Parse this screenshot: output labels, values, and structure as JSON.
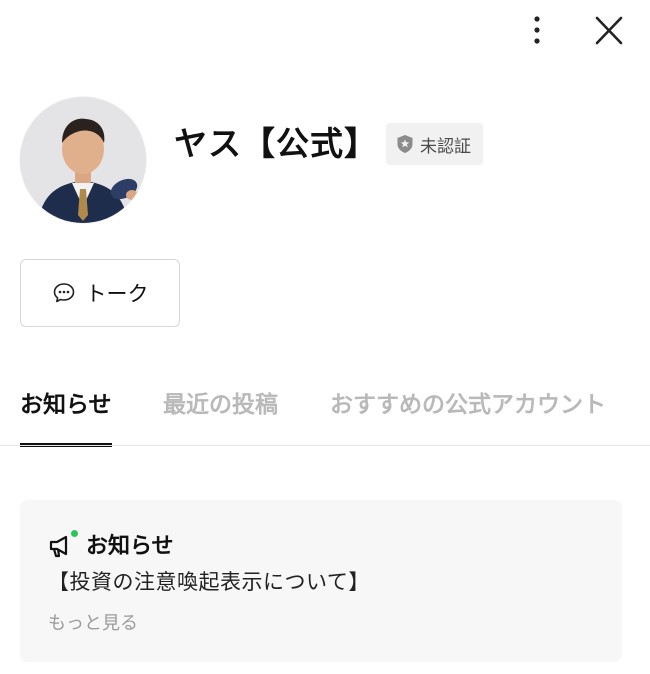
{
  "header": {
    "more_icon": "vertical-dots-icon",
    "close_icon": "close-icon"
  },
  "profile": {
    "name": "ヤス【公式】",
    "badge_label": "未認証",
    "badge_icon": "shield-star-icon",
    "avatar": "profile-photo"
  },
  "actions": {
    "talk_label": "トーク",
    "talk_icon": "chat-bubble-icon"
  },
  "tabs": [
    {
      "label": "お知らせ",
      "active": true
    },
    {
      "label": "最近の投稿",
      "active": false
    },
    {
      "label": "おすすめの公式アカウント",
      "active": false
    }
  ],
  "notice": {
    "icon": "megaphone-icon",
    "heading": "お知らせ",
    "title": "【投資の注意喚起表示について】",
    "more_label": "もっと見る"
  },
  "colors": {
    "active_tab": "#111111",
    "inactive_tab": "#b9b9b9",
    "notice_dot": "#2cc35a",
    "card_bg": "#f7f7f7"
  }
}
